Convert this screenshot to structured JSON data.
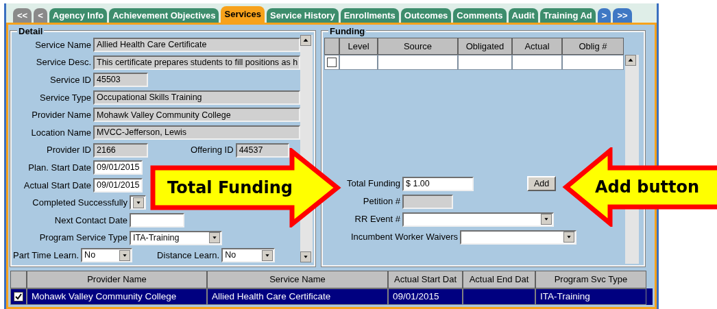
{
  "tab_nav": {
    "back": [
      "<<",
      "<"
    ],
    "forward": [
      ">",
      ">>"
    ]
  },
  "tabs": [
    {
      "label": "Agency Info",
      "selected": false
    },
    {
      "label": "Achievement Objectives",
      "selected": false
    },
    {
      "label": "Services",
      "selected": true
    },
    {
      "label": "Service History",
      "selected": false
    },
    {
      "label": "Enrollments",
      "selected": false
    },
    {
      "label": "Outcomes",
      "selected": false
    },
    {
      "label": "Comments",
      "selected": false
    },
    {
      "label": "Audit",
      "selected": false
    },
    {
      "label": "Training Ad",
      "selected": false
    }
  ],
  "detail": {
    "title": "Detail",
    "rows": [
      {
        "fields": [
          {
            "label": "Service Name",
            "value": "Allied Health Care Certificate",
            "kind": "readonly"
          }
        ]
      },
      {
        "fields": [
          {
            "label": "Service Desc.",
            "value": "This certificate prepares students to fill positions as h",
            "kind": "readonly"
          }
        ]
      },
      {
        "fields": [
          {
            "label": "Service ID",
            "value": "45503",
            "kind": "readonly"
          }
        ]
      },
      {
        "fields": [
          {
            "label": "Service Type",
            "value": "Occupational Skills Training",
            "kind": "readonly"
          }
        ]
      },
      {
        "fields": [
          {
            "label": "Provider Name",
            "value": "Mohawk Valley Community College",
            "kind": "readonly"
          }
        ]
      },
      {
        "fields": [
          {
            "label": "Location Name",
            "value": "MVCC-Jefferson, Lewis",
            "kind": "readonly"
          }
        ]
      },
      {
        "fields": [
          {
            "label": "Provider ID",
            "value": "2166",
            "kind": "readonly"
          },
          {
            "label": "Offering ID",
            "value": "44537",
            "kind": "readonly"
          }
        ]
      },
      {
        "fields": [
          {
            "label": "Plan. Start Date",
            "value": "09/01/2015",
            "kind": "input"
          }
        ]
      },
      {
        "fields": [
          {
            "label": "Actual Start Date",
            "value": "09/01/2015",
            "kind": "input"
          }
        ]
      },
      {
        "fields": [
          {
            "label": "Completed Successfully",
            "kind": "select"
          }
        ]
      },
      {
        "fields": [
          {
            "label": "Next Contact Date",
            "kind": "input"
          }
        ]
      },
      {
        "fields": [
          {
            "label": "Program Service Type",
            "value": "ITA-Training",
            "kind": "select"
          }
        ]
      },
      {
        "fields": [
          {
            "label": "Part Time Learn.",
            "value": "No",
            "kind": "select"
          },
          {
            "label": "Distance Learn.",
            "value": "No",
            "kind": "select"
          }
        ]
      }
    ]
  },
  "funding": {
    "title": "Funding",
    "columns": [
      "Level",
      "Source",
      "Obligated",
      "Actual",
      "Oblig #"
    ],
    "rows": [
      {
        "checked": false
      }
    ],
    "fields": [
      {
        "label": "Total Funding",
        "value": "$ 1.00",
        "kind": "input"
      },
      {
        "label": "Petition #",
        "kind": "readonly"
      },
      {
        "label": "RR Event #",
        "kind": "select"
      },
      {
        "label": "Incumbent Worker Waivers",
        "kind": "select"
      }
    ],
    "add_button": "Add"
  },
  "services_grid": {
    "columns": [
      "Provider Name",
      "Service Name",
      "Actual Start Dat",
      "Actual End Dat",
      "Program Svc Type"
    ],
    "rows": [
      {
        "checked": true,
        "selected": true,
        "cells": [
          "Mohawk Valley Community College",
          "Allied Health Care Certificate",
          "09/01/2015",
          "",
          "ITA-Training"
        ]
      }
    ]
  },
  "callouts": [
    {
      "text": "Total Funding",
      "kind": "arrow_right"
    },
    {
      "text": "Add button",
      "kind": "arrow_left"
    }
  ]
}
